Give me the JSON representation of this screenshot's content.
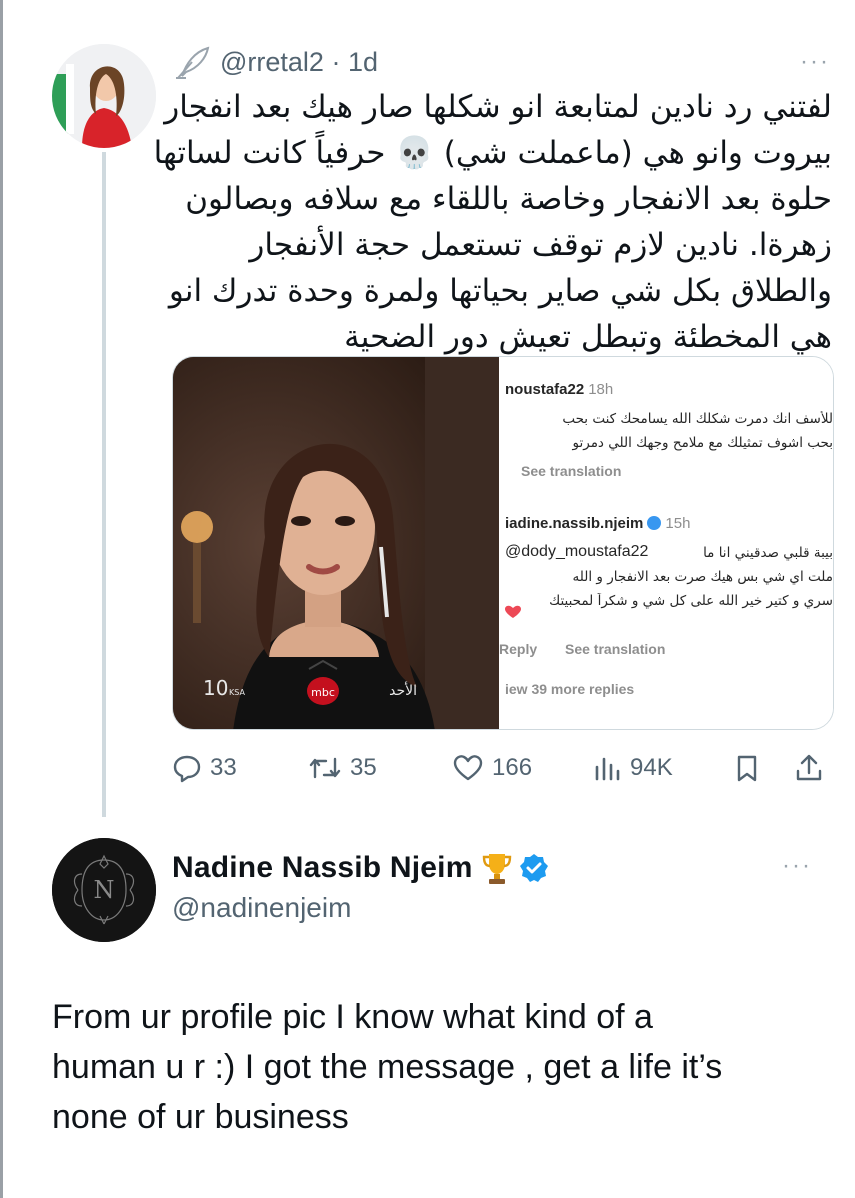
{
  "tweet": {
    "handle": "@rretal2",
    "time": "1d",
    "more": "···",
    "text_lines": [
      "لفتني رد نادين لمتابعة انو شكلها صار هيك بعد انفجار",
      "بيروت وانو هي (ماعملت شي) 💀 حرفياً كانت لساتها",
      "حلوة بعد الانفجار وخاصة باللقاء مع سلافه وبصالون",
      "زهرةا. نادين لازم توقف تستعمل حجة الأنفجار",
      "والطلاق بكل شي صاير بحياتها ولمرة وحدة تدرك انو",
      "هي المخطئة وتبطل تعيش دور الضحية"
    ],
    "media": {
      "photo_caption_left": "10",
      "photo_caption_ksa": "KSA",
      "photo_channel": "mbc",
      "photo_caption_right": "الأحد",
      "comment1_user": "noustafa22",
      "comment1_time": "18h",
      "comment1_line1": "للأسف انك دمرت شكلك الله يسامحك كنت بحب",
      "comment1_line2": "بحب اشوف تمثيلك مع ملامح وجهك اللي دمرتو",
      "comment1_translate": "See translation",
      "comment2_user": "iadine.nassib.njeim",
      "comment2_time": "15h",
      "comment2_mention": "@dody_moustafa22",
      "comment2_mention_tail": "بيبة قلبي صدقيني انا ما",
      "comment2_line1": "ملت اي شي بس هيك صرت بعد الانفجار و الله",
      "comment2_line2": "سري و كتير خير الله على كل شي و شكراً لمحبيتك",
      "comment2_reply": "Reply",
      "comment2_translate": "See translation",
      "view_replies": "iew 39 more replies"
    },
    "stats": {
      "replies": "33",
      "retweets": "35",
      "likes": "166",
      "views": "94K"
    }
  },
  "reply": {
    "name": "Nadine Nassib Njeim",
    "handle": "@nadinenjeim",
    "more": "···",
    "text_lines": [
      "From ur profile pic I know what kind of a",
      "human u r :) I got the message , get a life it’s",
      "none of ur business"
    ]
  },
  "colors": {
    "text": "#0f1419",
    "secondary": "#536471",
    "verified": "#1d9bf0",
    "thread_line": "#cfd9de"
  },
  "icons": [
    "feather-icon",
    "reply-icon",
    "retweet-icon",
    "like-icon",
    "views-icon",
    "bookmark-icon",
    "share-icon",
    "trophy-icon",
    "verified-badge-icon",
    "more-icon"
  ]
}
